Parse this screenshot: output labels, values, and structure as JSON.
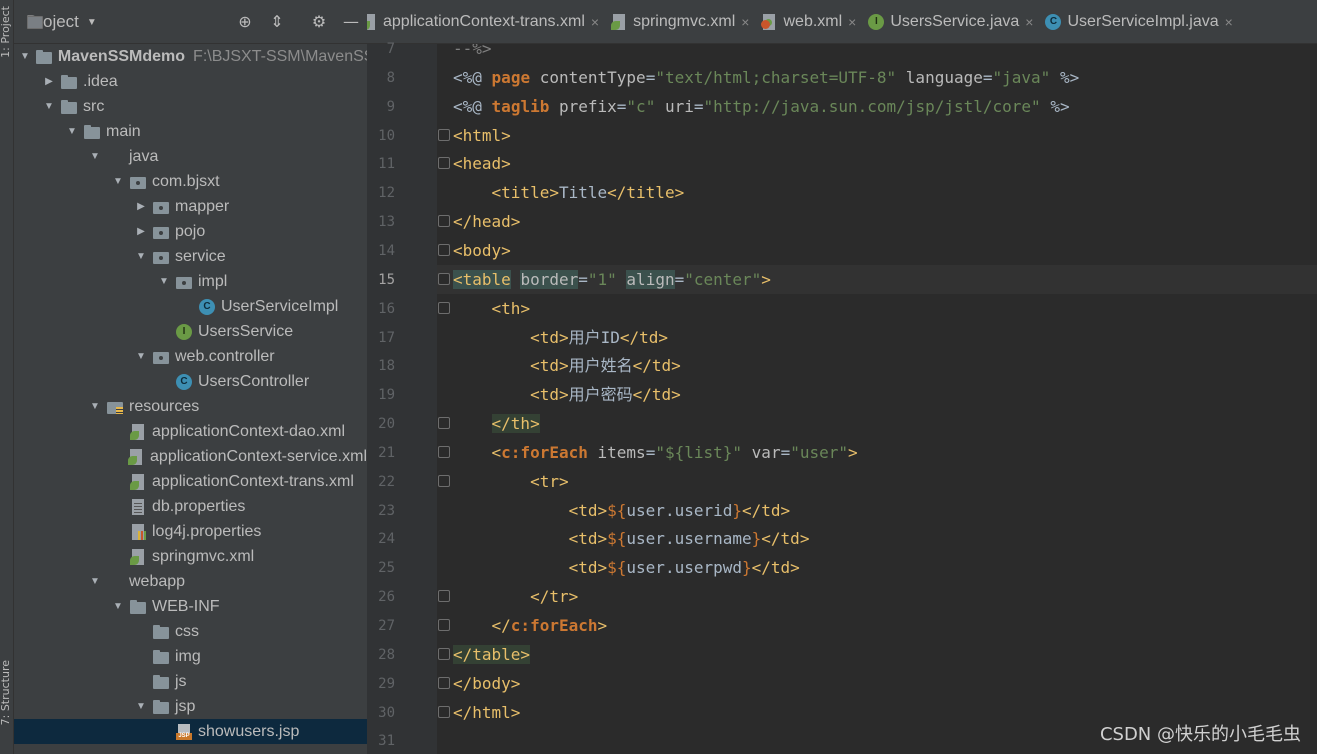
{
  "left_strip": {
    "project_label": "1: Project",
    "structure_label": "7: Structure"
  },
  "project_panel": {
    "title": "Project",
    "icons": [
      "target-icon",
      "collapse-icon",
      "gear-icon",
      "minimize-icon"
    ],
    "tree": [
      {
        "label": "MavenSSMdemo",
        "path": "F:\\BJSXT-SSM\\MavenSS",
        "icon": "module",
        "arrow": "down",
        "depth": 0,
        "bold": true
      },
      {
        "label": ".idea",
        "icon": "folder",
        "arrow": "right",
        "depth": 1
      },
      {
        "label": "src",
        "icon": "folder",
        "arrow": "down",
        "depth": 1
      },
      {
        "label": "main",
        "icon": "folder",
        "arrow": "down",
        "depth": 2
      },
      {
        "label": "java",
        "icon": "srcfolder",
        "arrow": "down",
        "depth": 3
      },
      {
        "label": "com.bjsxt",
        "icon": "pkg",
        "arrow": "down",
        "depth": 4
      },
      {
        "label": "mapper",
        "icon": "pkg",
        "arrow": "right",
        "depth": 5
      },
      {
        "label": "pojo",
        "icon": "pkg",
        "arrow": "right",
        "depth": 5
      },
      {
        "label": "service",
        "icon": "pkg",
        "arrow": "down",
        "depth": 5
      },
      {
        "label": "impl",
        "icon": "pkg",
        "arrow": "down",
        "depth": 6
      },
      {
        "label": "UserServiceImpl",
        "icon": "cls",
        "arrow": "",
        "depth": 7
      },
      {
        "label": "UsersService",
        "icon": "intf",
        "arrow": "",
        "depth": 6
      },
      {
        "label": "web.controller",
        "icon": "pkg",
        "arrow": "down",
        "depth": 5
      },
      {
        "label": "UsersController",
        "icon": "cls",
        "arrow": "",
        "depth": 6
      },
      {
        "label": "resources",
        "icon": "res",
        "arrow": "down",
        "depth": 3
      },
      {
        "label": "applicationContext-dao.xml",
        "icon": "spring",
        "arrow": "",
        "depth": 4
      },
      {
        "label": "applicationContext-service.xml",
        "icon": "spring",
        "arrow": "",
        "depth": 4
      },
      {
        "label": "applicationContext-trans.xml",
        "icon": "spring",
        "arrow": "",
        "depth": 4
      },
      {
        "label": "db.properties",
        "icon": "props",
        "arrow": "",
        "depth": 4
      },
      {
        "label": "log4j.properties",
        "icon": "log",
        "arrow": "",
        "depth": 4
      },
      {
        "label": "springmvc.xml",
        "icon": "spring",
        "arrow": "",
        "depth": 4
      },
      {
        "label": "webapp",
        "icon": "webfolder",
        "arrow": "down",
        "depth": 3
      },
      {
        "label": "WEB-INF",
        "icon": "folder",
        "arrow": "down",
        "depth": 4
      },
      {
        "label": "css",
        "icon": "folder",
        "arrow": "",
        "depth": 5
      },
      {
        "label": "img",
        "icon": "folder",
        "arrow": "",
        "depth": 5
      },
      {
        "label": "js",
        "icon": "folder",
        "arrow": "",
        "depth": 5
      },
      {
        "label": "jsp",
        "icon": "folder",
        "arrow": "down",
        "depth": 5
      },
      {
        "label": "showusers.jsp",
        "icon": "jsp",
        "arrow": "",
        "depth": 6,
        "selected": true
      }
    ]
  },
  "tabs": [
    {
      "label": "applicationContext-trans.xml",
      "icon": "spring"
    },
    {
      "label": "springmvc.xml",
      "icon": "spring"
    },
    {
      "label": "web.xml",
      "icon": "xml"
    },
    {
      "label": "UsersService.java",
      "icon": "intf"
    },
    {
      "label": "UserServiceImpl.java",
      "icon": "cls"
    }
  ],
  "editor": {
    "current_line": 15,
    "lines": [
      {
        "n": "7",
        "code": "--%>",
        "fold": false
      },
      {
        "n": "8",
        "code": "<%@ page contentType=\"text/html;charset=UTF-8\" language=\"java\" %>",
        "fold": false
      },
      {
        "n": "9",
        "code": "<%@ taglib prefix=\"c\" uri=\"http://java.sun.com/jsp/jstl/core\" %>",
        "fold": false
      },
      {
        "n": "10",
        "code": "<html>",
        "fold": true
      },
      {
        "n": "11",
        "code": "<head>",
        "fold": true
      },
      {
        "n": "12",
        "code": "    <title>Title</title>",
        "fold": false
      },
      {
        "n": "13",
        "code": "</head>",
        "fold": true
      },
      {
        "n": "14",
        "code": "<body>",
        "fold": true
      },
      {
        "n": "15",
        "code": "<table border=\"1\" align=\"center\">",
        "fold": true
      },
      {
        "n": "16",
        "code": "    <th>",
        "fold": true
      },
      {
        "n": "17",
        "code": "        <td>用户ID</td>",
        "fold": false
      },
      {
        "n": "18",
        "code": "        <td>用户姓名</td>",
        "fold": false
      },
      {
        "n": "19",
        "code": "        <td>用户密码</td>",
        "fold": false
      },
      {
        "n": "20",
        "code": "    </th>",
        "fold": true
      },
      {
        "n": "21",
        "code": "    <c:forEach items=\"${list}\" var=\"user\">",
        "fold": true
      },
      {
        "n": "22",
        "code": "        <tr>",
        "fold": true
      },
      {
        "n": "23",
        "code": "            <td>${user.userid}</td>",
        "fold": false
      },
      {
        "n": "24",
        "code": "            <td>${user.username}</td>",
        "fold": false
      },
      {
        "n": "25",
        "code": "            <td>${user.userpwd}</td>",
        "fold": false
      },
      {
        "n": "26",
        "code": "        </tr>",
        "fold": true
      },
      {
        "n": "27",
        "code": "    </c:forEach>",
        "fold": true
      },
      {
        "n": "28",
        "code": "</table>",
        "fold": true
      },
      {
        "n": "29",
        "code": "</body>",
        "fold": true
      },
      {
        "n": "30",
        "code": "</html>",
        "fold": true
      },
      {
        "n": "31",
        "code": "",
        "fold": false
      }
    ]
  },
  "watermark": "CSDN @快乐的小毛毛虫",
  "colors": {
    "tag": "#e8bf6a",
    "attr": "#bababa",
    "string": "#6a8759",
    "keyword": "#cc7832",
    "el": "#bbb529",
    "panel_bg": "#3c3f41",
    "editor_bg": "#2b2b2b"
  }
}
